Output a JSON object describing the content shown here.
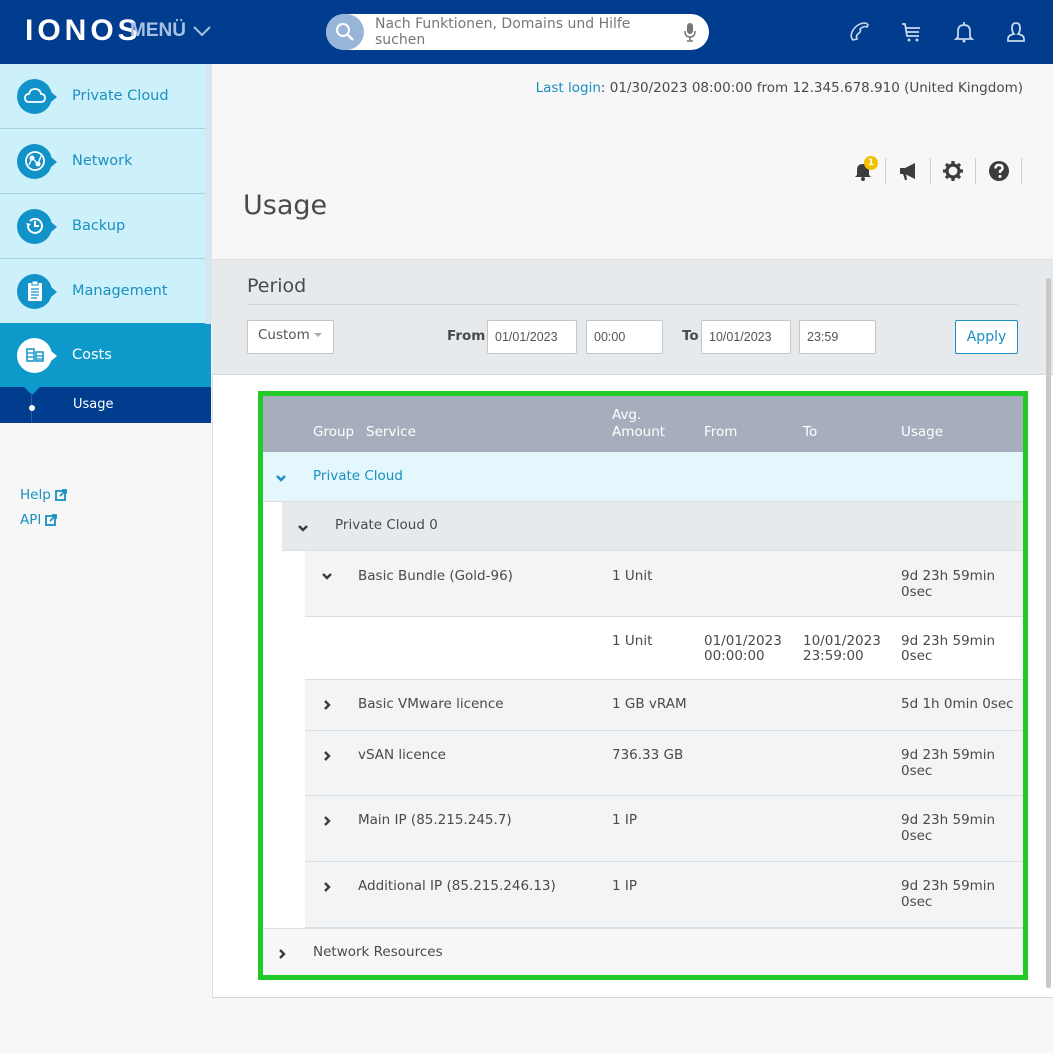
{
  "header": {
    "logo": "IONOS",
    "menu_label": "MENÜ",
    "search_placeholder": "Nach Funktionen, Domains und Hilfe suchen",
    "icons": [
      "phone-icon",
      "cart-icon",
      "bell-icon",
      "user-icon"
    ]
  },
  "sidebar": {
    "items": [
      {
        "label": "Private Cloud",
        "icon": "cloud-icon"
      },
      {
        "label": "Network",
        "icon": "globe-network-icon"
      },
      {
        "label": "Backup",
        "icon": "history-clock-icon"
      },
      {
        "label": "Management",
        "icon": "clipboard-icon"
      },
      {
        "label": "Costs",
        "icon": "coins-icon",
        "active": true
      }
    ],
    "sub_item": "Usage",
    "links": [
      {
        "label": "Help",
        "icon": "external-link-icon"
      },
      {
        "label": "API",
        "icon": "external-link-icon"
      }
    ]
  },
  "last_login": {
    "label": "Last login",
    "value": ": 01/30/2023 08:00:00 from 12.345.678.910 (United Kingdom)"
  },
  "toolbar": {
    "notification_count": "1",
    "icons": [
      "bell-icon",
      "megaphone-icon",
      "gear-icon",
      "help-icon"
    ]
  },
  "page_title": "Usage",
  "period": {
    "title": "Period",
    "preset": "Custom",
    "from_label": "From",
    "from_date": "01/01/2023",
    "from_time": "00:00",
    "to_label": "To",
    "to_date": "10/01/2023",
    "to_time": "23:59",
    "apply_label": "Apply"
  },
  "table": {
    "headers": {
      "group": "Group",
      "service": "Service",
      "avg_amount_1": "Avg.",
      "avg_amount_2": "Amount",
      "from": "From",
      "to": "To",
      "usage": "Usage"
    },
    "group_1": {
      "label": "Private Cloud",
      "expanded": true
    },
    "subgroup_1": {
      "label": "Private Cloud 0",
      "expanded": true
    },
    "rows": [
      {
        "service": "Basic Bundle (Gold-96)",
        "amount": "1 Unit",
        "from": "",
        "to": "",
        "usage_1": "9d 23h 59min",
        "usage_2": "0sec",
        "expanded": true
      },
      {
        "service": "",
        "amount": "1 Unit",
        "from_1": "01/01/2023",
        "from_2": "00:00:00",
        "to_1": "10/01/2023",
        "to_2": "23:59:00",
        "usage_1": "9d 23h 59min",
        "usage_2": "0sec"
      },
      {
        "service": "Basic VMware licence",
        "amount": "1 GB vRAM",
        "usage_1": "5d 1h 0min 0sec",
        "usage_2": ""
      },
      {
        "service": "vSAN licence",
        "amount": "736.33 GB",
        "usage_1": "9d 23h 59min",
        "usage_2": "0sec"
      },
      {
        "service": "Main IP (85.215.245.7)",
        "amount": "1 IP",
        "usage_1": "9d 23h 59min",
        "usage_2": "0sec"
      },
      {
        "service": "Additional IP (85.215.246.13)",
        "amount": "1 IP",
        "usage_1": "9d 23h 59min",
        "usage_2": "0sec"
      }
    ],
    "group_2": {
      "label": "Network Resources",
      "expanded": false
    }
  },
  "colors": {
    "header_bg": "#003d8f",
    "accent": "#1a8fc0",
    "highlight_border": "#23c928",
    "badge": "#f5c000"
  }
}
